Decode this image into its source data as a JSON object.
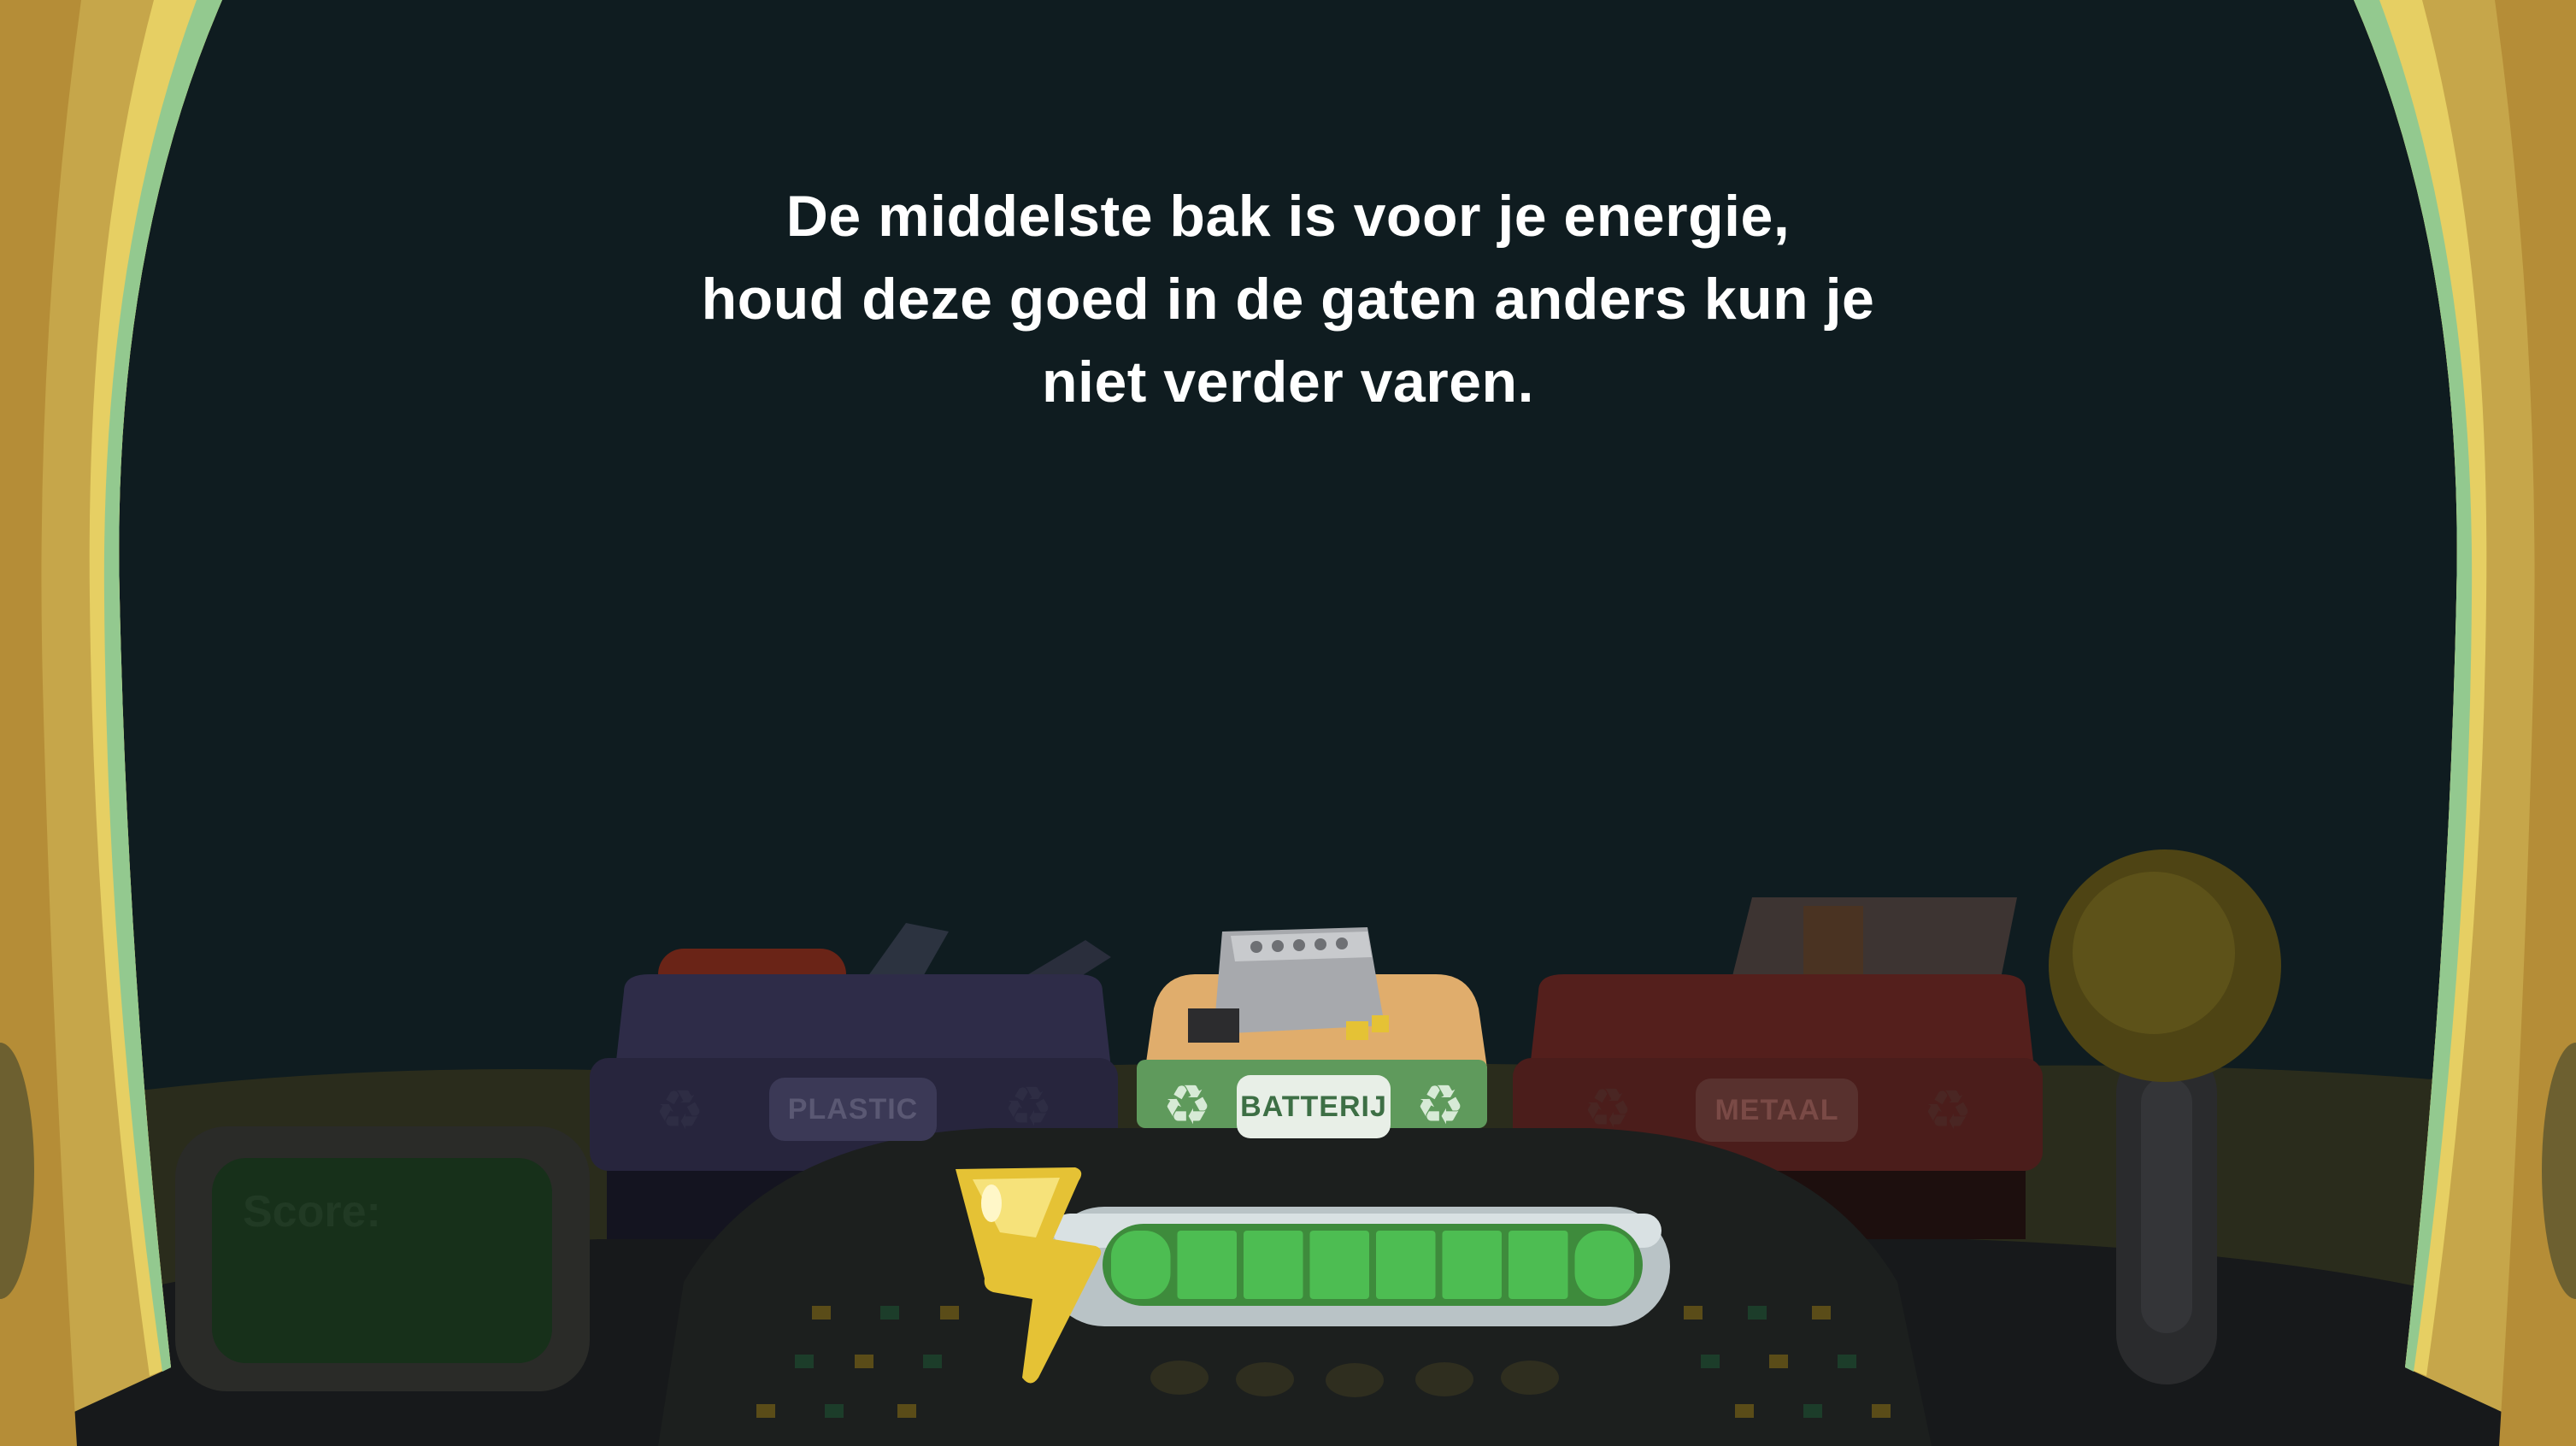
{
  "tutorial": {
    "lines": [
      "De middelste bak is voor je energie,",
      "houd deze goed in de gaten anders kun je",
      "niet verder varen."
    ]
  },
  "bins": {
    "left": {
      "label": "PLASTIC",
      "color": "#27253d"
    },
    "middle": {
      "label": "BATTERIJ",
      "color": "#5f9a5c"
    },
    "right": {
      "label": "METAAL",
      "color": "#4b1d1b"
    }
  },
  "score": {
    "label": "Score:"
  },
  "energy": {
    "level": 1.0,
    "segments": 8,
    "color": "#4dbd52"
  },
  "icons": {
    "recycle": "recycle-icon",
    "energy": "lightning-bolt-icon",
    "joystick": "joystick-icon"
  },
  "colors": {
    "sky": "#0f1c20",
    "frame": "#c6a64a",
    "frame_inner": "#93c98f",
    "dashboard": "#1b1f1d"
  }
}
